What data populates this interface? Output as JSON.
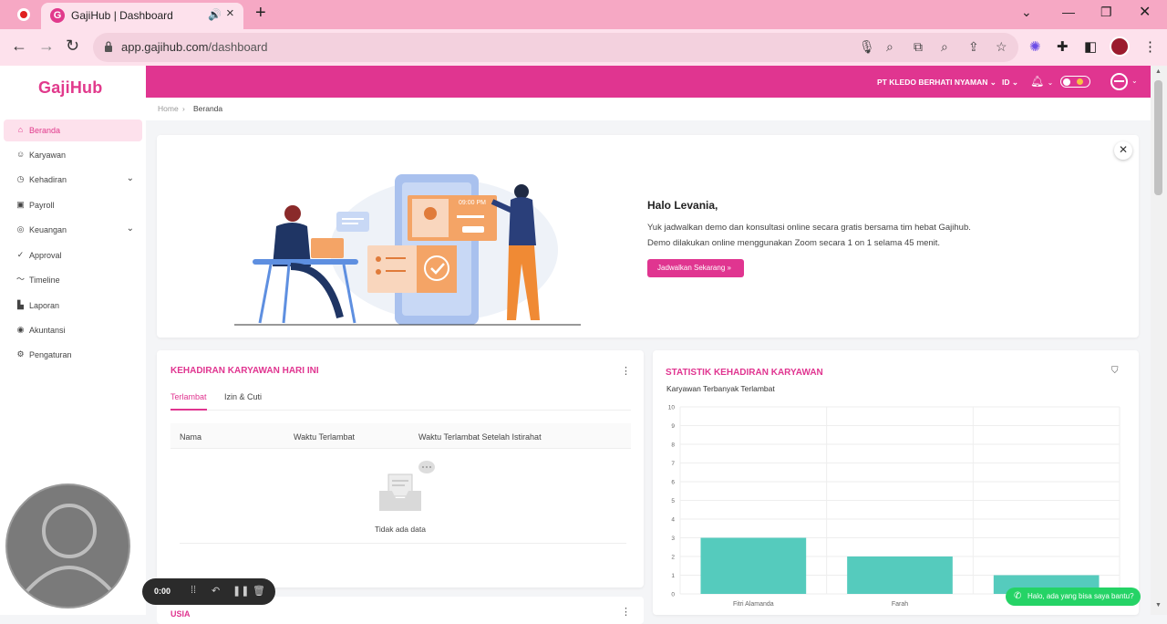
{
  "browser": {
    "tab_title": "GajiHub | Dashboard",
    "url_host": "app.gajihub.com",
    "url_path": "/dashboard"
  },
  "sidebar": {
    "logo": "GajiHub",
    "items": [
      {
        "label": "Beranda",
        "icon": "home-icon",
        "active": true
      },
      {
        "label": "Karyawan",
        "icon": "users-icon"
      },
      {
        "label": "Kehadiran",
        "icon": "clock-icon",
        "expandable": true
      },
      {
        "label": "Payroll",
        "icon": "payroll-icon"
      },
      {
        "label": "Keuangan",
        "icon": "finance-icon",
        "expandable": true
      },
      {
        "label": "Approval",
        "icon": "approval-icon"
      },
      {
        "label": "Timeline",
        "icon": "timeline-icon"
      },
      {
        "label": "Laporan",
        "icon": "report-icon"
      },
      {
        "label": "Akuntansi",
        "icon": "accounting-icon"
      },
      {
        "label": "Pengaturan",
        "icon": "settings-icon"
      }
    ]
  },
  "header": {
    "company": "PT KLEDO BERHATI NYAMAN",
    "language": "ID"
  },
  "breadcrumb": {
    "home": "Home",
    "current": "Beranda"
  },
  "banner": {
    "greeting": "Halo Levania,",
    "line1": "Yuk jadwalkan demo dan konsultasi online secara gratis bersama tim hebat Gajihub.",
    "line2": "Demo dilakukan online menggunakan Zoom secara 1 on 1 selama 45 menit.",
    "cta_label": "Jadwalkan Sekarang",
    "illustration_time": "09:00 PM"
  },
  "attendance_card": {
    "title": "KEHADIRAN KARYAWAN HARI INI",
    "tabs": [
      "Terlambat",
      "Izin & Cuti"
    ],
    "columns": [
      "Nama",
      "Waktu Terlambat",
      "Waktu Terlambat Setelah Istirahat"
    ],
    "empty_text": "Tidak ada data"
  },
  "stats_card": {
    "title": "STATISTIK KEHADIRAN KARYAWAN",
    "subtitle": "Karyawan Terbanyak Terlambat"
  },
  "chart_data": {
    "type": "bar",
    "title": "Karyawan Terbanyak Terlambat",
    "categories": [
      "Fitri Alamanda",
      "Farah",
      ""
    ],
    "values": [
      3,
      2,
      1
    ],
    "ylim": [
      0,
      10
    ],
    "yticks": [
      0,
      1,
      2,
      3,
      4,
      5,
      6,
      7,
      8,
      9,
      10
    ],
    "color": "#55cbbd",
    "grid": true
  },
  "bottom_card": {
    "title": "USIA"
  },
  "recorder": {
    "time": "0:00"
  },
  "whatsapp": {
    "label": "Halo, ada yang bisa saya bantu?"
  },
  "colors": {
    "brand": "#e03590",
    "chart_bar": "#55cbbd",
    "whatsapp": "#25d366"
  }
}
